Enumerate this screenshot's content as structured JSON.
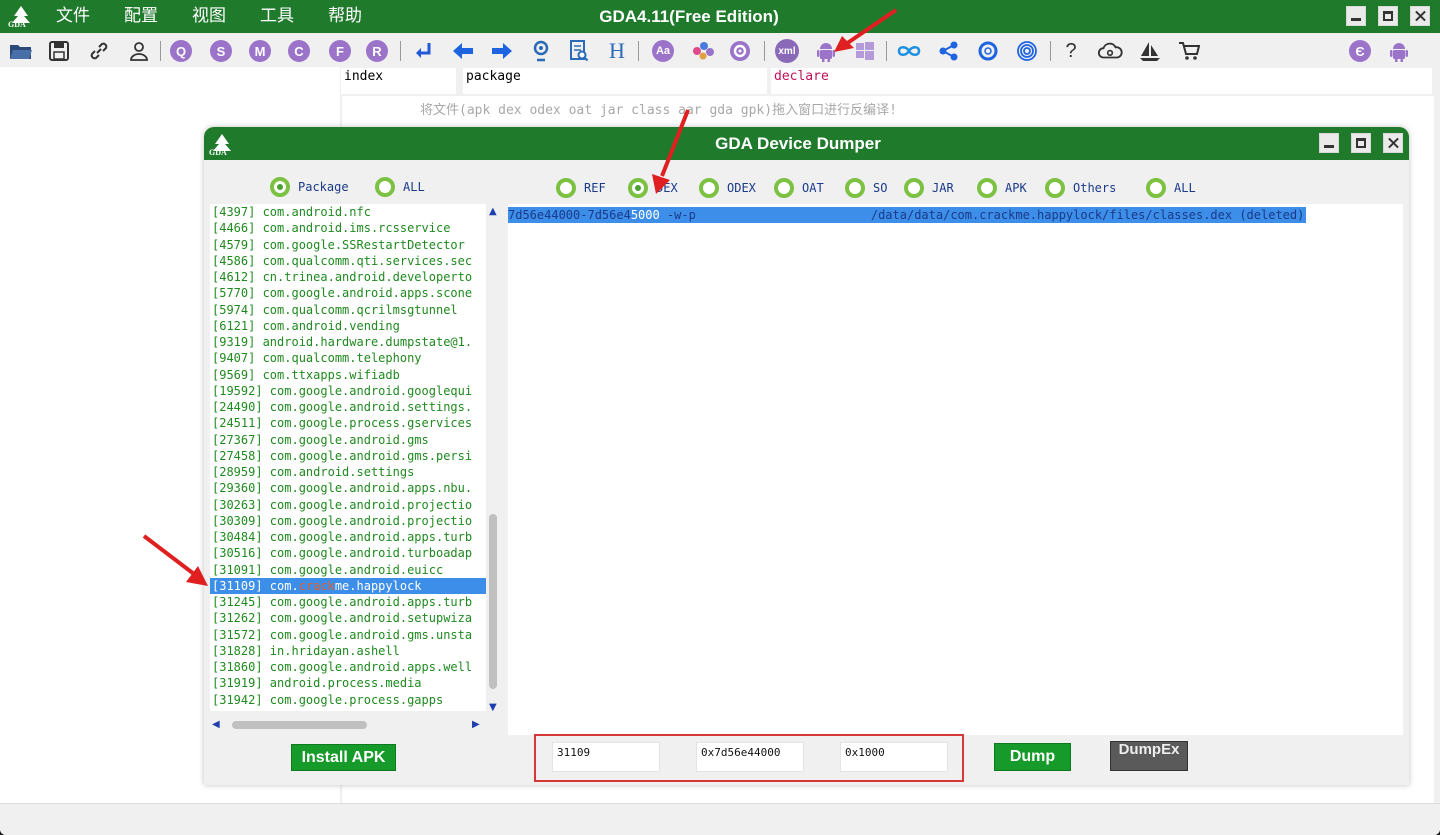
{
  "app": {
    "title": "GDA4.11(Free Edition)",
    "menu": [
      "文件",
      "配置",
      "视图",
      "工具",
      "帮助"
    ],
    "logo_text": "GDA"
  },
  "toolbar": {
    "circle_letters": [
      "Q",
      "S",
      "M",
      "C",
      "F",
      "R"
    ],
    "text_icons": {
      "h": "H",
      "aa": "Aa",
      "xml": "xml",
      "help": "?",
      "e": "Є"
    }
  },
  "table": {
    "headers": [
      "index",
      "package",
      "declare"
    ],
    "drop_hint": "将文件(apk dex odex oat jar class aar gda gpk)拖入窗口进行反编译!"
  },
  "dialog": {
    "title": "GDA Device Dumper",
    "logo_text": "GDA",
    "left_radios": [
      {
        "label": "Package",
        "checked": true
      },
      {
        "label": "ALL",
        "checked": false
      }
    ],
    "type_radios": [
      {
        "label": "REF",
        "checked": false
      },
      {
        "label": "DEX",
        "checked": true
      },
      {
        "label": "ODEX",
        "checked": false
      },
      {
        "label": "OAT",
        "checked": false
      },
      {
        "label": "SO",
        "checked": false
      },
      {
        "label": "JAR",
        "checked": false
      },
      {
        "label": "APK",
        "checked": false
      },
      {
        "label": "Others",
        "checked": false
      },
      {
        "label": "ALL",
        "checked": false
      }
    ],
    "processes": [
      "[4397] com.android.nfc",
      "[4466] com.android.ims.rcsservice",
      "[4579] com.google.SSRestartDetector",
      "[4586] com.qualcomm.qti.services.sec",
      "[4612] cn.trinea.android.developerto",
      "[5770] com.google.android.apps.scone",
      "[5974] com.qualcomm.qcrilmsgtunnel",
      "[6121] com.android.vending",
      "[9319] android.hardware.dumpstate@1.",
      "[9407] com.qualcomm.telephony",
      "[9569] com.ttxapps.wifiadb",
      "[19592] com.google.android.googlequi",
      "[24490] com.google.android.settings.",
      "[24511] com.google.process.gservices",
      "[27367] com.google.android.gms",
      "[27458] com.google.android.gms.persi",
      "[28959] com.android.settings",
      "[29360] com.google.android.apps.nbu.",
      "[30263] com.google.android.projectio",
      "[30309] com.google.android.projectio",
      "[30484] com.google.android.apps.turb",
      "[30516] com.google.android.turboadap",
      "[31091] com.google.android.euicc",
      "[31109] com.crackme.happylock",
      "[31245] com.google.android.apps.turb",
      "[31262] com.google.android.setupwiza",
      "[31572] com.google.android.gms.unsta",
      "[31828] in.hridayan.ashell",
      "[31860] com.google.android.apps.well",
      "[31919] android.process.media",
      "[31942] com.google.process.gapps"
    ],
    "selected_process": {
      "pid": "[31109]",
      "pre": " com.",
      "hl": "crack",
      "post": "me.happylock"
    },
    "memory_row": {
      "range_a": "7d56e44000-7d56e4",
      "range_b": "5000",
      "perm": " -w-p",
      "path": "/data/data/com.crackme.happylock/files/classes.dex (deleted)"
    },
    "install_button": "Install APK",
    "dump_button": "Dump",
    "dumpex_button": "DumpEx",
    "fields": {
      "pid": "31109",
      "address": "0x7d56e44000",
      "size": "0x1000"
    }
  },
  "colors": {
    "title_green": "#1f7a2c",
    "button_green": "#169a2a",
    "selection_blue": "#3d8ee8",
    "annotation_red": "#d63838",
    "radio_green": "#7cc142"
  }
}
